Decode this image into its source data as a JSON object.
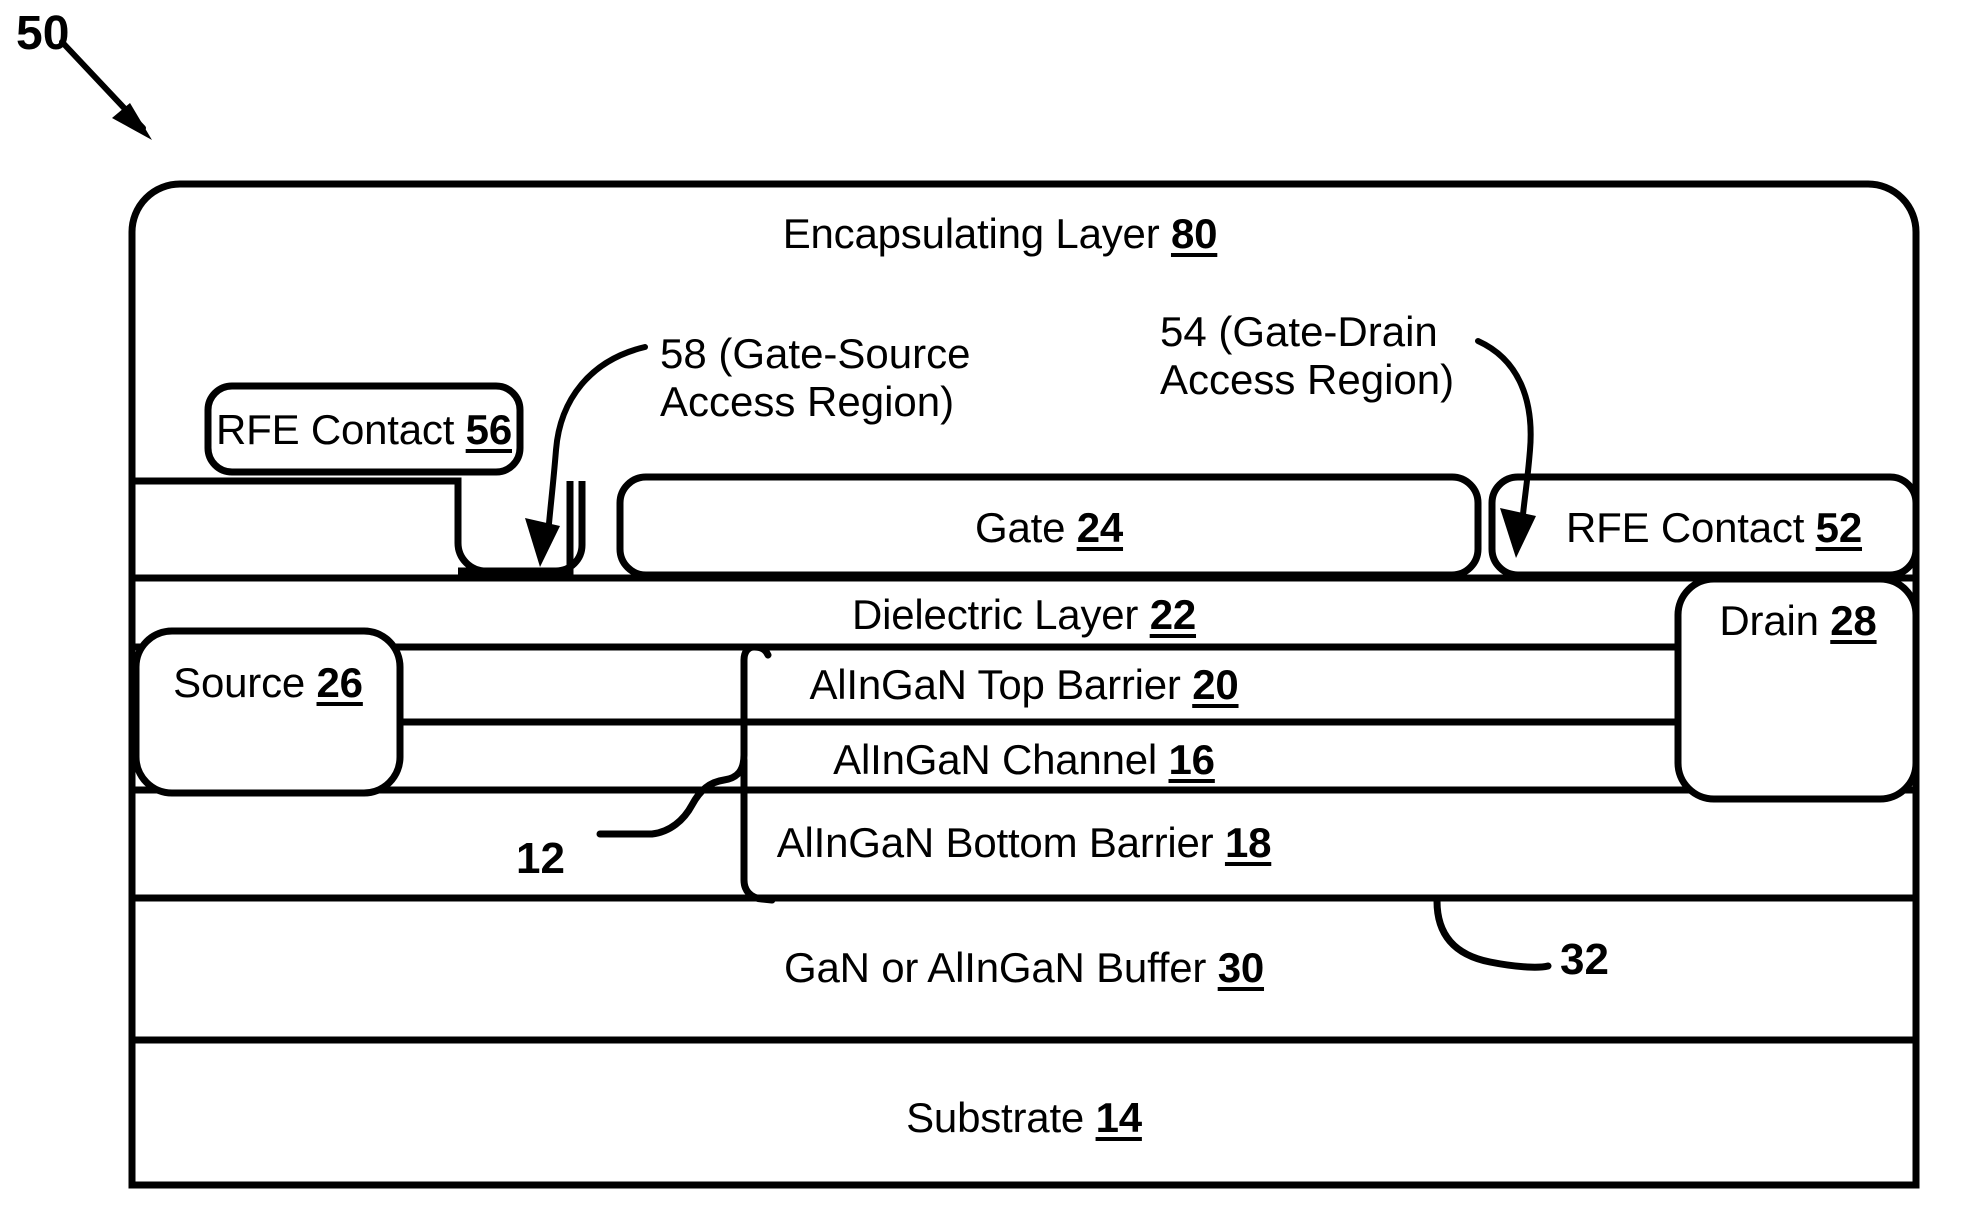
{
  "figure": {
    "title_ref": "50",
    "type": "semiconductor-device-cross-section"
  },
  "layers": [
    {
      "id": "encapsulating",
      "label": "Encapsulating Layer ",
      "ref": "80"
    },
    {
      "id": "gate",
      "label": "Gate ",
      "ref": "24"
    },
    {
      "id": "rfe_contact_52",
      "label": "RFE Contact ",
      "ref": "52"
    },
    {
      "id": "rfe_contact_56",
      "label": "RFE Contact ",
      "ref": "56"
    },
    {
      "id": "dielectric",
      "label": "Dielectric Layer ",
      "ref": "22"
    },
    {
      "id": "top_barrier",
      "label": "AlInGaN Top Barrier ",
      "ref": "20"
    },
    {
      "id": "channel",
      "label": "AlInGaN Channel ",
      "ref": "16"
    },
    {
      "id": "bottom_barrier",
      "label": "AlInGaN Bottom Barrier ",
      "ref": "18"
    },
    {
      "id": "buffer",
      "label": "GaN or AlInGaN Buffer ",
      "ref": "30"
    },
    {
      "id": "substrate",
      "label": "Substrate ",
      "ref": "14"
    },
    {
      "id": "source",
      "label": "Source ",
      "ref": "26"
    },
    {
      "id": "drain",
      "label": "Drain ",
      "ref": "28"
    }
  ],
  "callouts": [
    {
      "id": "gate_source_access",
      "line1": "58 (Gate-Source",
      "line2": "Access Region)"
    },
    {
      "id": "gate_drain_access",
      "line1": "54 (Gate-Drain",
      "line2": "Access Region)"
    },
    {
      "id": "heterostructure",
      "number": "12"
    },
    {
      "id": "interface",
      "number": "32"
    }
  ],
  "colors": {
    "stroke": "#000000",
    "fill": "#ffffff",
    "text": "#000000"
  }
}
